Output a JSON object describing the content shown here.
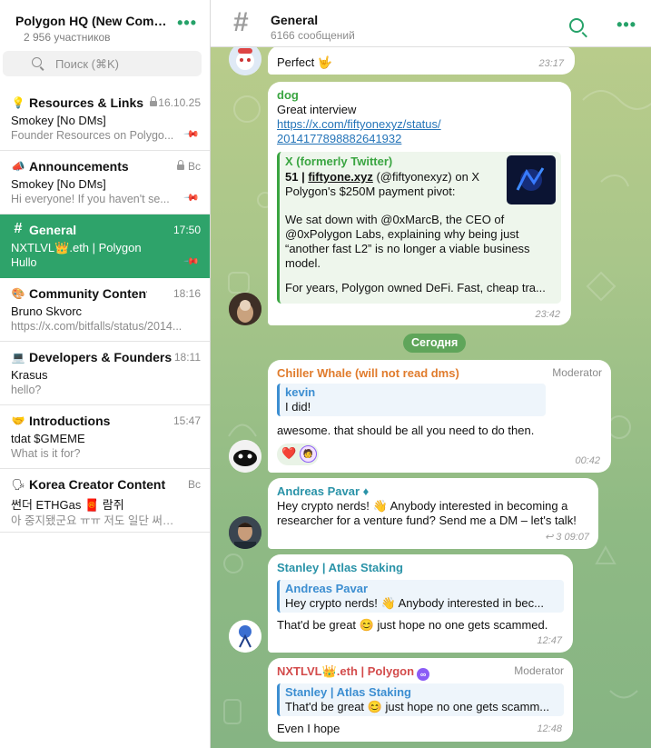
{
  "sidebar": {
    "title": "Polygon HQ (New Comm...",
    "subtitle": "2 956 участников",
    "menu_icon": "more-dots-icon",
    "search_placeholder": "Поиск (⌘K)",
    "topics": [
      {
        "emoji": "💡",
        "name": "Resources & Links",
        "date": "16.10.25",
        "sender": "Smokey [No DMs]",
        "preview": "Founder Resources on Polygo...",
        "pinned": true,
        "locked": true
      },
      {
        "emoji": "📣",
        "name": "Announcements",
        "date": "Вс",
        "sender": "Smokey [No DMs]",
        "preview": "Hi everyone!  If you haven't se...",
        "pinned": true,
        "locked": true
      },
      {
        "emoji": "#",
        "name": "General",
        "date": "17:50",
        "sender": "NXTLVL👑.eth | Polygon",
        "preview": "Hullo",
        "pinned": true,
        "active": true
      },
      {
        "emoji": "🎨",
        "name": "Community Content",
        "date": "18:16",
        "sender": "Bruno Skvorc",
        "preview": "https://x.com/bitfalls/status/2014..."
      },
      {
        "emoji": "💻",
        "name": "Developers & Founders",
        "date": "18:11",
        "sender": "Krasus",
        "preview": "hello?"
      },
      {
        "emoji": "🤝",
        "name": "Introductions",
        "date": "15:47",
        "sender": "tdat $GMEME",
        "preview": "What is it for?"
      },
      {
        "emoji": "🗣",
        "name": "Korea Creator Content",
        "date": "Вс",
        "sender": "썬더 ETHGas 🧧 람쥐",
        "preview": "아 중지됐군요 ㅠㅠ 저도 일단 써버려서..."
      }
    ]
  },
  "header": {
    "title": "General",
    "subtitle": "6166 сообщений",
    "search_icon": "search-icon",
    "menu_icon": "more-dots-icon"
  },
  "messages": {
    "m0": {
      "text": "Perfect 🤟",
      "time": "23:17"
    },
    "m1": {
      "author": "dog",
      "text": "Great interview",
      "link": "https://x.com/fiftyonexyz/status/2014177898882641932",
      "link_line1": "https://x.com/fiftyonexyz/status/",
      "link_line2": "2014177898882641932",
      "preview_site": "X (formerly Twitter)",
      "preview_title_num": "51 | ",
      "preview_title_link": "fiftyone.xyz",
      "preview_title_rest": " (@fiftyonexyz) on X",
      "preview_line2": "Polygon's $250M payment pivot:",
      "preview_body": "We sat down with @0xMarcB, the CEO of @0xPolygon Labs, explaining why being just “another fast L2” is no longer a viable business model.",
      "preview_tail": "For years, Polygon owned DeFi. Fast, cheap tra...",
      "time": "23:42"
    },
    "date_divider": "Сегодня",
    "m2": {
      "author": "Chiller Whale (will not read dms)",
      "role": "Moderator",
      "reply_author": "kevin",
      "reply_text": "I did!",
      "text": "awesome. that should be all you need to do then.",
      "reactions": [
        "❤️",
        "🧑"
      ],
      "time": "00:42"
    },
    "m3": {
      "author": "Andreas Pavar ♦",
      "text": "Hey crypto nerds! 👋 Anybody interested in becoming a researcher for a venture fund? Send me a DM – let's talk!",
      "replies": "3",
      "time": "09:07"
    },
    "m4": {
      "author": "Stanley | Atlas Staking",
      "reply_author": "Andreas Pavar",
      "reply_text": "Hey crypto nerds! 👋 Anybody interested in bec...",
      "text": "That'd be great 😊 just hope no one gets scammed.",
      "time": "12:47"
    },
    "m5": {
      "author": "NXTLVL👑.eth | Polygon",
      "role": "Moderator",
      "reply_author": "Stanley | Atlas Staking",
      "reply_text": "That'd be great 😊 just hope no one gets scamm...",
      "text": "Even I hope",
      "time": "12:48"
    }
  },
  "colors": {
    "accent": "#26a269",
    "active_topic": "#2ea36a",
    "link": "#2474b8",
    "reply_bar": "#3c8ed1",
    "author_green": "#3aa541",
    "author_orange": "#e07b2c",
    "author_teal": "#2a93a8",
    "author_red": "#d34b4b"
  }
}
